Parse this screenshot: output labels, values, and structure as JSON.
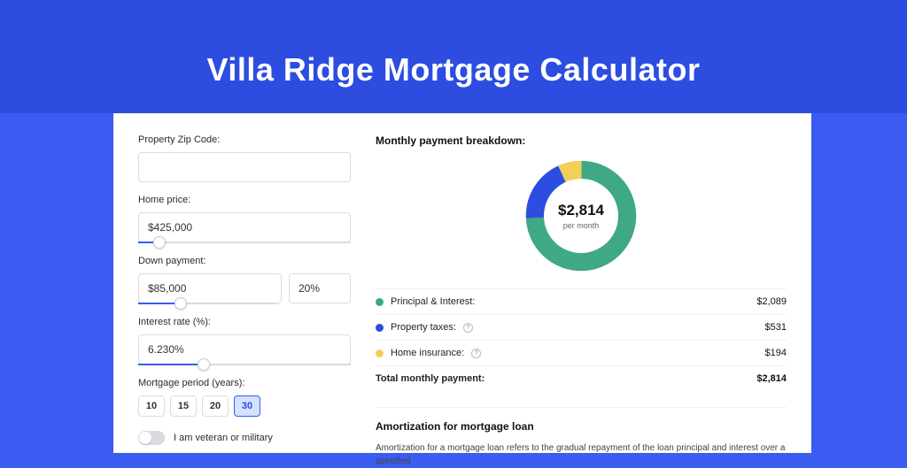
{
  "title": "Villa Ridge Mortgage Calculator",
  "form": {
    "zip_label": "Property Zip Code:",
    "zip_value": "",
    "home_price_label": "Home price:",
    "home_price_value": "$425,000",
    "down_payment_label": "Down payment:",
    "down_payment_value": "$85,000",
    "down_payment_pct": "20%",
    "interest_label": "Interest rate (%):",
    "interest_value": "6.230%",
    "period_label": "Mortgage period (years):",
    "period_options": [
      "10",
      "15",
      "20",
      "30"
    ],
    "period_selected": "30",
    "veteran_label": "I am veteran or military",
    "veteran_checked": false
  },
  "breakdown": {
    "title": "Monthly payment breakdown:",
    "center_amount": "$2,814",
    "center_sub": "per month",
    "items": [
      {
        "label": "Principal & Interest:",
        "value": "$2,089",
        "color": "#3fa884",
        "info": false
      },
      {
        "label": "Property taxes:",
        "value": "$531",
        "color": "#2c4de0",
        "info": true
      },
      {
        "label": "Home insurance:",
        "value": "$194",
        "color": "#f2cf57",
        "info": true
      }
    ],
    "total_label": "Total monthly payment:",
    "total_value": "$2,814"
  },
  "chart_data": {
    "type": "pie",
    "title": "Monthly payment breakdown",
    "categories": [
      "Principal & Interest",
      "Property taxes",
      "Home insurance"
    ],
    "values": [
      2089,
      531,
      194
    ],
    "colors": [
      "#3fa884",
      "#2c4de0",
      "#f2cf57"
    ],
    "center_label": "$2,814 per month"
  },
  "amortization": {
    "title": "Amortization for mortgage loan",
    "text": "Amortization for a mortgage loan refers to the gradual repayment of the loan principal and interest over a specified"
  }
}
